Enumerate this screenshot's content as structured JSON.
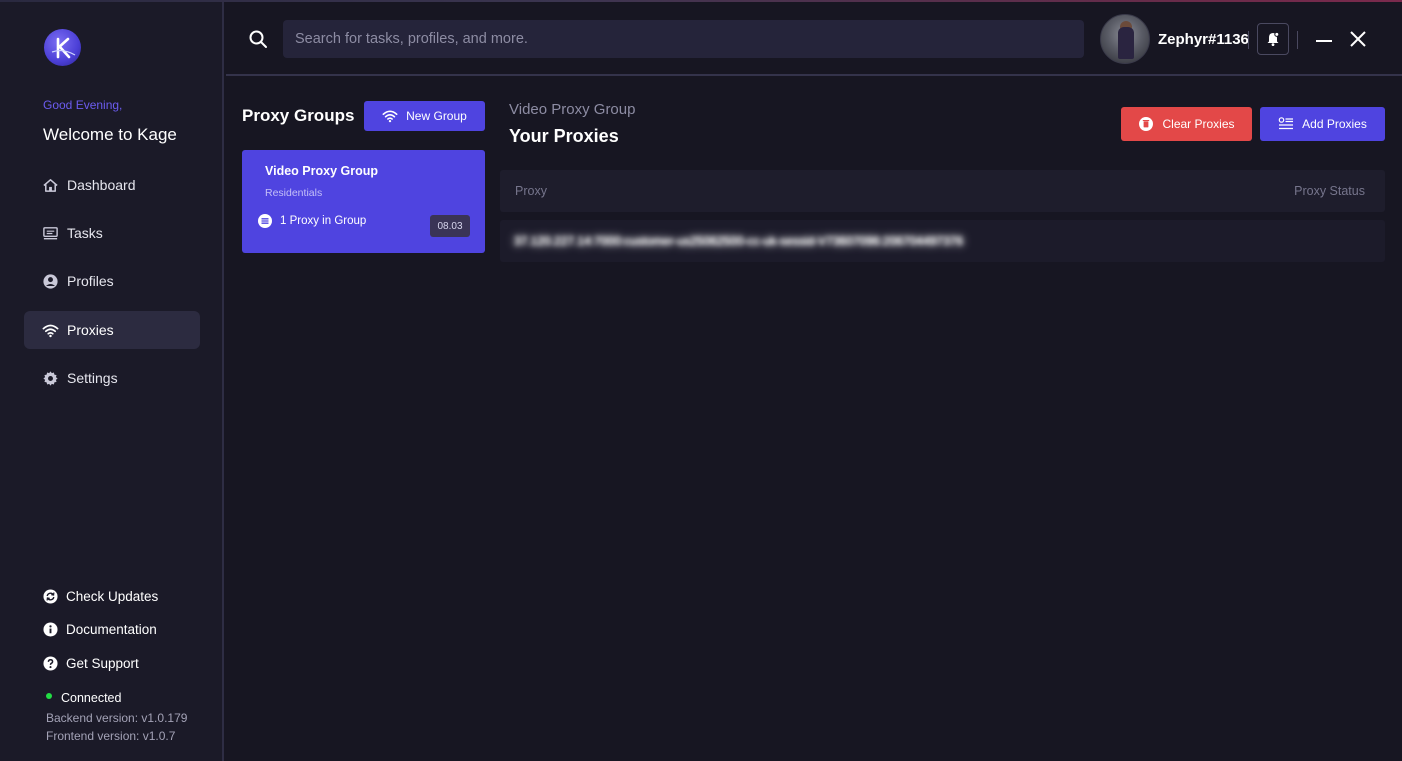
{
  "sidebar": {
    "greeting": "Good Evening,",
    "welcome": "Welcome to Kage",
    "nav": [
      {
        "label": "Dashboard",
        "icon": "home-icon"
      },
      {
        "label": "Tasks",
        "icon": "tasks-icon"
      },
      {
        "label": "Profiles",
        "icon": "profile-icon"
      },
      {
        "label": "Proxies",
        "icon": "wifi-icon",
        "active": true
      },
      {
        "label": "Settings",
        "icon": "gear-icon"
      }
    ],
    "links": [
      {
        "label": "Check Updates",
        "icon": "refresh-icon"
      },
      {
        "label": "Documentation",
        "icon": "info-icon"
      },
      {
        "label": "Get Support",
        "icon": "help-icon"
      }
    ],
    "status": "Connected",
    "backend_version": "Backend version: v1.0.179",
    "frontend_version": "Frontend version: v1.0.7"
  },
  "header": {
    "search_placeholder": "Search for tasks, profiles, and more.",
    "username": "Zephyr#1136"
  },
  "groups": {
    "title": "Proxy Groups",
    "new_group_label": "New Group",
    "items": [
      {
        "name": "Video Proxy Group",
        "type": "Residentials",
        "count": "1 Proxy in Group",
        "badge": "08.03"
      }
    ]
  },
  "proxies": {
    "group_name": "Video Proxy Group",
    "title": "Your Proxies",
    "clear_label": "Clear Proxies",
    "add_label": "Add Proxies",
    "columns": [
      "Proxy",
      "Proxy Status"
    ],
    "rows": [
      {
        "proxy": "37.120.227.14:7000:customer-us25062500-cc-uk-sessid-V73607096:206704497376",
        "status": ""
      }
    ]
  },
  "colors": {
    "accent": "#4f44e0",
    "danger": "#e34848",
    "connected": "#22dd44"
  }
}
